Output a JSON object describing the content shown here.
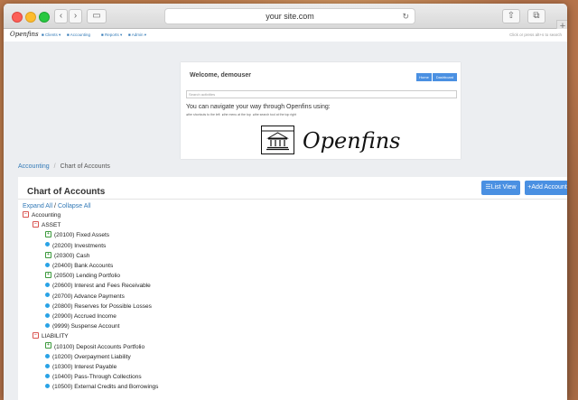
{
  "browser": {
    "url": "your site.com"
  },
  "appnav": {
    "logo": "Openfins",
    "items": [
      "Clients",
      "Accounting",
      "Reports",
      "Admin"
    ],
    "hint": "Click or press alt+s to search"
  },
  "welcome": {
    "title": "Welcome, demouser",
    "home_button": "Home",
    "dashboard_button": "Dashboard",
    "search_placeholder": "Search activities",
    "navigate_text": "You can navigate your way through Openfins using:",
    "tips": [
      "the shortcuts to the left",
      "the menu at the top",
      "the search tool at the top right"
    ],
    "brand": "Openfins"
  },
  "breadcrumb": {
    "parent": "Accounting",
    "current": "Chart of Accounts"
  },
  "panel": {
    "title": "Chart of Accounts",
    "list_view_button": "List View",
    "add_account_button": "+Add Account",
    "expand_all": "Expand All",
    "collapse_all": "Collapse All"
  },
  "tree": [
    {
      "level": 0,
      "marker": "minus",
      "label": "Accounting"
    },
    {
      "level": 1,
      "marker": "minus",
      "label": "ASSET"
    },
    {
      "level": 2,
      "marker": "plus",
      "label": "(20100) Fixed Assets"
    },
    {
      "level": 2,
      "marker": "dot",
      "label": "(20200) Investments"
    },
    {
      "level": 2,
      "marker": "plus",
      "label": "(20300) Cash"
    },
    {
      "level": 2,
      "marker": "dot",
      "label": "(20400) Bank Accounts"
    },
    {
      "level": 2,
      "marker": "plus",
      "label": "(20500) Lending Portfolio"
    },
    {
      "level": 2,
      "marker": "dot",
      "label": "(20600) Interest and Fees Receivable"
    },
    {
      "level": 2,
      "marker": "dot",
      "label": "(20700) Advance Payments"
    },
    {
      "level": 2,
      "marker": "dot",
      "label": "(20800) Reserves for Possible Losses"
    },
    {
      "level": 2,
      "marker": "dot",
      "label": "(20900) Accrued Income"
    },
    {
      "level": 2,
      "marker": "dot",
      "label": "(9999) Suspense Account"
    },
    {
      "level": 1,
      "marker": "minus",
      "label": "LIABILITY"
    },
    {
      "level": 2,
      "marker": "plus",
      "label": "(10100) Deposit Accounts Portfolio"
    },
    {
      "level": 2,
      "marker": "dot",
      "label": "(10200) Overpayment Liability"
    },
    {
      "level": 2,
      "marker": "dot",
      "label": "(10300) Interest Payable"
    },
    {
      "level": 2,
      "marker": "dot",
      "label": "(10400) Pass-Through Collections"
    },
    {
      "level": 2,
      "marker": "dot",
      "label": "(10500) External Credits and Borrowings"
    }
  ]
}
